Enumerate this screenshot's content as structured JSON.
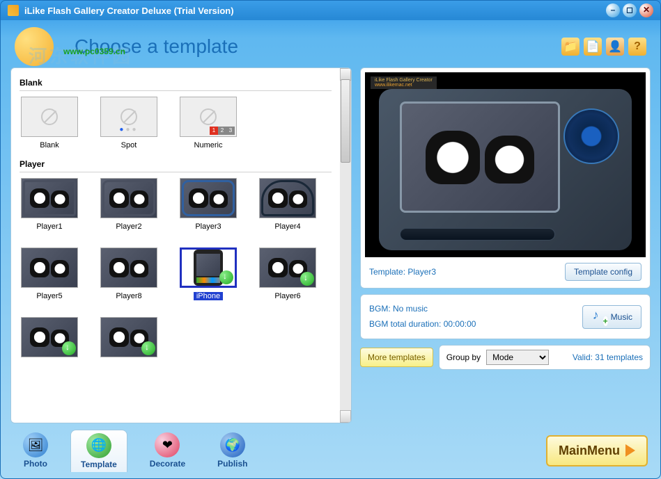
{
  "window": {
    "title": "iLike Flash Gallery Creator Deluxe (Trial Version)"
  },
  "watermark": {
    "text": "河东软件园",
    "url": "www.pc0359.cn"
  },
  "header": {
    "title": "Choose a template",
    "tools": {
      "folder": "Open folder",
      "new": "New project",
      "user": "Account",
      "help": "?"
    }
  },
  "sections": {
    "blank": {
      "label": "Blank",
      "items": [
        {
          "name": "Blank"
        },
        {
          "name": "Spot"
        },
        {
          "name": "Numeric"
        }
      ]
    },
    "player": {
      "label": "Player",
      "items": [
        {
          "name": "Player1"
        },
        {
          "name": "Player2"
        },
        {
          "name": "Player3"
        },
        {
          "name": "Player4"
        },
        {
          "name": "Player5"
        },
        {
          "name": "Player8"
        },
        {
          "name": "iPhone",
          "selected": true
        },
        {
          "name": "Player6"
        }
      ]
    }
  },
  "preview": {
    "watermark": "iLike Flash Gallery Creator",
    "watermark_url": "www.ilikemac.net",
    "template_label": "Template: Player3",
    "config_btn": "Template config"
  },
  "bgm": {
    "line1": "BGM: No music",
    "line2": "BGM total duration: 00:00:00",
    "music_btn": "Music"
  },
  "bottom": {
    "more": "More templates",
    "group_label": "Group by",
    "group_options": [
      "Mode"
    ],
    "group_value": "Mode",
    "valid": "Valid: 31 templates"
  },
  "nav": {
    "photo": "Photo",
    "template": "Template",
    "decorate": "Decorate",
    "publish": "Publish",
    "mainmenu": "MainMenu"
  }
}
